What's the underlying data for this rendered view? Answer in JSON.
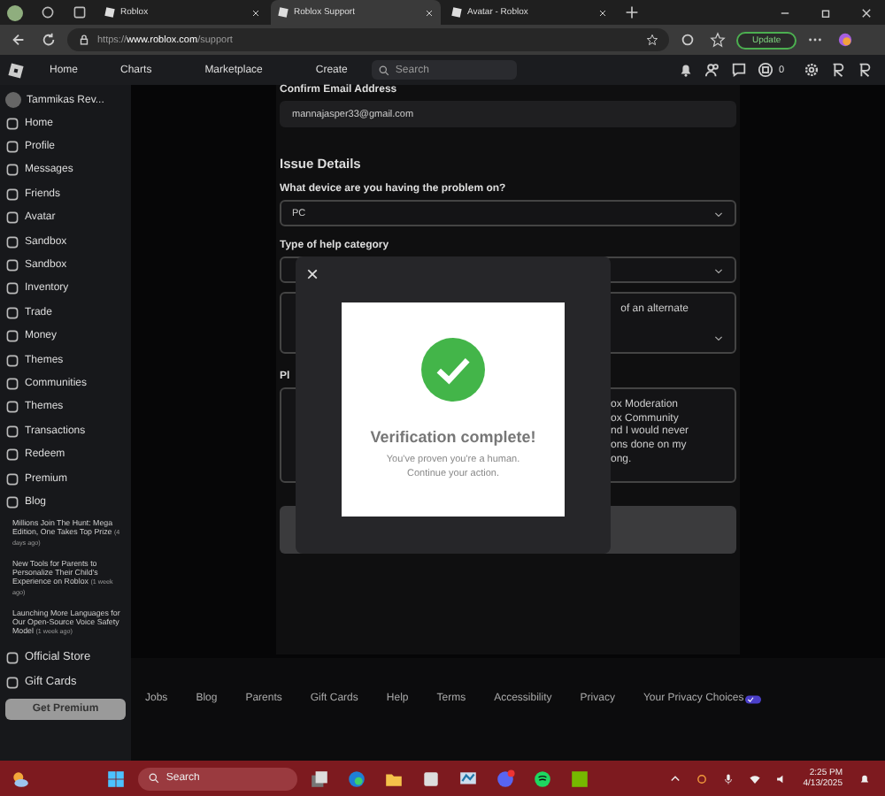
{
  "browser": {
    "tabs": [
      {
        "title": "Roblox",
        "selected": false
      },
      {
        "title": "Roblox Support",
        "selected": true
      },
      {
        "title": "Avatar - Roblox",
        "selected": false
      }
    ],
    "url": {
      "scheme": "https://",
      "host": "www.roblox.com",
      "path": "/support"
    },
    "update_button": "Update"
  },
  "nav": {
    "links": [
      "Home",
      "Charts",
      "Marketplace",
      "Create"
    ],
    "search": {
      "placeholder": "Search"
    },
    "robux": "0"
  },
  "sidebar": {
    "user": "Tammikas Rev...",
    "items": [
      "Home",
      "Profile",
      "Messages",
      "Friends",
      "Avatar",
      "Sandbox",
      "Sandbox",
      "Inventory",
      "Trade",
      "Money",
      "Themes",
      "Communities",
      "Themes",
      "Transactions",
      "Redeem",
      "Premium",
      "Blog"
    ],
    "news": [
      {
        "title": "Millions Join The Hunt: Mega Edition, One Takes Top Prize",
        "time": "(4 days ago)"
      },
      {
        "title": "New Tools for Parents to Personalize Their Child's Experience on Roblox",
        "time": "(1 week ago)"
      },
      {
        "title": "Launching More Languages for Our Open-Source Voice Safety Model",
        "time": "(1 week ago)"
      }
    ],
    "extra_items": [
      "Official Store",
      "Gift Cards"
    ],
    "premium_button": "Get Premium"
  },
  "form": {
    "email_label": "Confirm Email Address",
    "email_value": "mannajasper33@gmail.com",
    "section": "Issue Details",
    "device_label": "What device are you having the problem on?",
    "device_value": "PC",
    "category_label": "Type of help category",
    "subcategory_fragment": "of an alternate",
    "description_label_fragment": "Pl",
    "description_fragments": [
      "ox Moderation",
      "ox Community",
      "nd I would never",
      "ons done on my",
      "ong."
    ]
  },
  "modal": {
    "close": "×",
    "title": "Verification complete!",
    "message": [
      "You've proven you're a human.",
      "Continue your action."
    ]
  },
  "footer": {
    "links": [
      "Jobs",
      "Blog",
      "Parents",
      "Gift Cards",
      "Help",
      "Terms",
      "Accessibility",
      "Privacy",
      "Your Privacy Choices"
    ]
  },
  "taskbar": {
    "search": {
      "placeholder": "Search"
    },
    "time": "2:25 PM",
    "date": "4/13/2025"
  }
}
